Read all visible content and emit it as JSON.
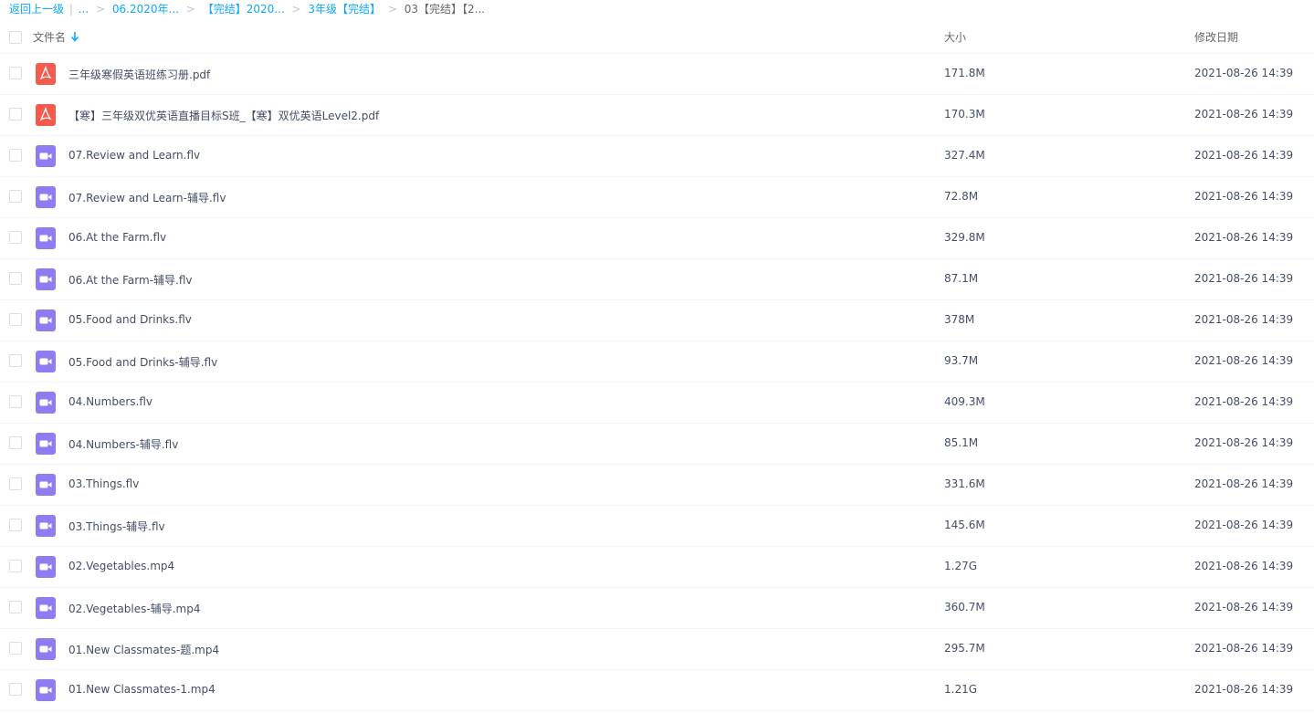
{
  "breadcrumb": {
    "back": "返回上一级",
    "divider": "|",
    "ellipsis": "...",
    "items": [
      "06.2020年...",
      "【完结】2020...",
      "3年级【完结】"
    ],
    "current": "03【完结】【2..."
  },
  "header": {
    "name": "文件名",
    "size": "大小",
    "date": "修改日期"
  },
  "colors": {
    "accent": "#09aaff",
    "pdf": "#f35b4f",
    "video": "#8e7cf0"
  },
  "files": [
    {
      "icon": "pdf-icon",
      "name": "三年级寒假英语班练习册.pdf",
      "size": "171.8M",
      "date": "2021-08-26 14:39"
    },
    {
      "icon": "pdf-icon",
      "name": "【寒】三年级双优英语直播目标S班_【寒】双优英语Level2.pdf",
      "size": "170.3M",
      "date": "2021-08-26 14:39"
    },
    {
      "icon": "video-icon",
      "name": "07.Review and Learn.flv",
      "size": "327.4M",
      "date": "2021-08-26 14:39"
    },
    {
      "icon": "video-icon",
      "name": "07.Review and Learn-辅导.flv",
      "size": "72.8M",
      "date": "2021-08-26 14:39"
    },
    {
      "icon": "video-icon",
      "name": "06.At the Farm.flv",
      "size": "329.8M",
      "date": "2021-08-26 14:39"
    },
    {
      "icon": "video-icon",
      "name": "06.At the Farm-辅导.flv",
      "size": "87.1M",
      "date": "2021-08-26 14:39"
    },
    {
      "icon": "video-icon",
      "name": "05.Food and Drinks.flv",
      "size": "378M",
      "date": "2021-08-26 14:39"
    },
    {
      "icon": "video-icon",
      "name": "05.Food and Drinks-辅导.flv",
      "size": "93.7M",
      "date": "2021-08-26 14:39"
    },
    {
      "icon": "video-icon",
      "name": "04.Numbers.flv",
      "size": "409.3M",
      "date": "2021-08-26 14:39"
    },
    {
      "icon": "video-icon",
      "name": "04.Numbers-辅导.flv",
      "size": "85.1M",
      "date": "2021-08-26 14:39"
    },
    {
      "icon": "video-icon",
      "name": "03.Things.flv",
      "size": "331.6M",
      "date": "2021-08-26 14:39"
    },
    {
      "icon": "video-icon",
      "name": "03.Things-辅导.flv",
      "size": "145.6M",
      "date": "2021-08-26 14:39"
    },
    {
      "icon": "video-icon",
      "name": "02.Vegetables.mp4",
      "size": "1.27G",
      "date": "2021-08-26 14:39"
    },
    {
      "icon": "video-icon",
      "name": "02.Vegetables-辅导.mp4",
      "size": "360.7M",
      "date": "2021-08-26 14:39"
    },
    {
      "icon": "video-icon",
      "name": "01.New Classmates-题.mp4",
      "size": "295.7M",
      "date": "2021-08-26 14:39"
    },
    {
      "icon": "video-icon",
      "name": "01.New Classmates-1.mp4",
      "size": "1.21G",
      "date": "2021-08-26 14:39"
    }
  ]
}
